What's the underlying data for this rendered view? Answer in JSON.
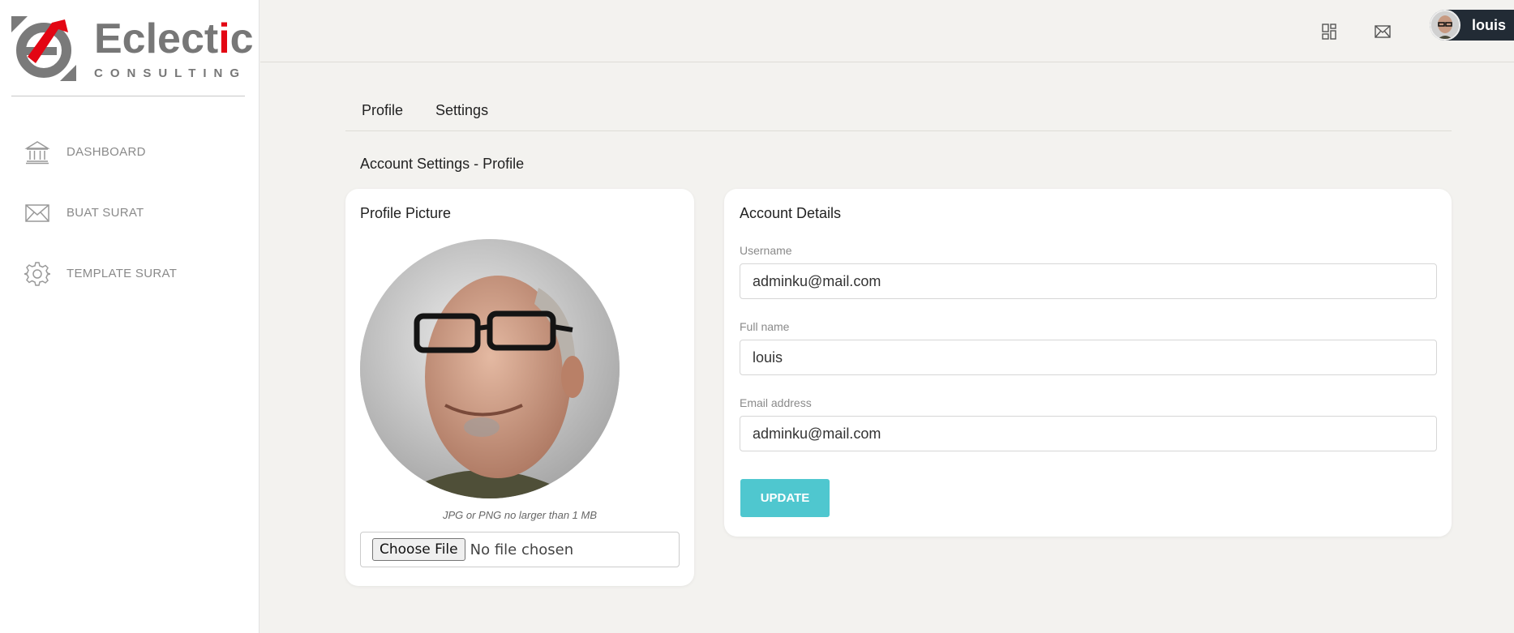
{
  "brand": {
    "name_part1": "Eclect",
    "name_accent": "i",
    "name_part2": "c",
    "tagline": "CONSULTING",
    "accent_color": "#e30613"
  },
  "sidebar": {
    "items": [
      {
        "label": "DASHBOARD",
        "icon": "bank-icon"
      },
      {
        "label": "BUAT SURAT",
        "icon": "mail-icon"
      },
      {
        "label": "TEMPLATE SURAT",
        "icon": "gear-icon"
      }
    ]
  },
  "header": {
    "icons": [
      "dashboard-icon",
      "envelope-icon"
    ],
    "user_name": "louis"
  },
  "tabs": [
    {
      "label": "Profile"
    },
    {
      "label": "Settings"
    }
  ],
  "section_title": "Account Settings - Profile",
  "profile_card": {
    "title": "Profile Picture",
    "hint": "JPG or PNG no larger than 1 MB",
    "file_button": "Choose File",
    "file_status": "No file chosen"
  },
  "account_card": {
    "title": "Account Details",
    "fields": [
      {
        "label": "Username",
        "value": "adminku@mail.com"
      },
      {
        "label": "Full name",
        "value": "louis"
      },
      {
        "label": "Email address",
        "value": "adminku@mail.com"
      }
    ],
    "submit_label": "UPDATE",
    "submit_color": "#4fc7cf"
  }
}
